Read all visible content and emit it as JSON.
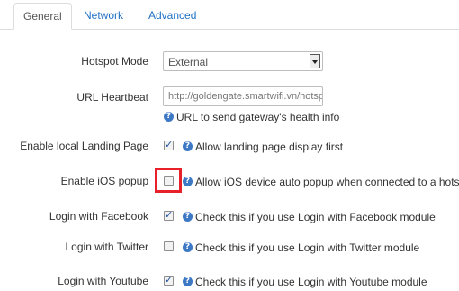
{
  "tabs": [
    {
      "label": "General",
      "active": true
    },
    {
      "label": "Network",
      "active": false
    },
    {
      "label": "Advanced",
      "active": false
    }
  ],
  "hotspot_mode": {
    "label": "Hotspot Mode",
    "value": "External"
  },
  "url_heartbeat": {
    "label": "URL Heartbeat",
    "value": "http://goldengate.smartwifi.vn/hotsp",
    "help": "URL to send gateway's health info"
  },
  "options": [
    {
      "key": "landing",
      "label": "Enable local Landing Page",
      "checked": true,
      "help": "Allow landing page display first"
    },
    {
      "key": "ios",
      "label": "Enable iOS popup",
      "checked": false,
      "help": "Allow iOS device auto popup when connected to a hotspot"
    },
    {
      "key": "facebook",
      "label": "Login with Facebook",
      "checked": true,
      "help": "Check this if you use Login with Facebook module"
    },
    {
      "key": "twitter",
      "label": "Login with Twitter",
      "checked": false,
      "help": "Check this if you use Login with Twitter module"
    },
    {
      "key": "youtube",
      "label": "Login with Youtube",
      "checked": true,
      "help": "Check this if you use Login with Youtube module"
    }
  ],
  "icons": {
    "help": "info-circle-icon",
    "check": "checkmark-icon"
  },
  "colors": {
    "link": "#1e6fc4",
    "help_icon": "#3d78c4",
    "highlight": "#e8202a",
    "check": "#1c4f9c"
  }
}
